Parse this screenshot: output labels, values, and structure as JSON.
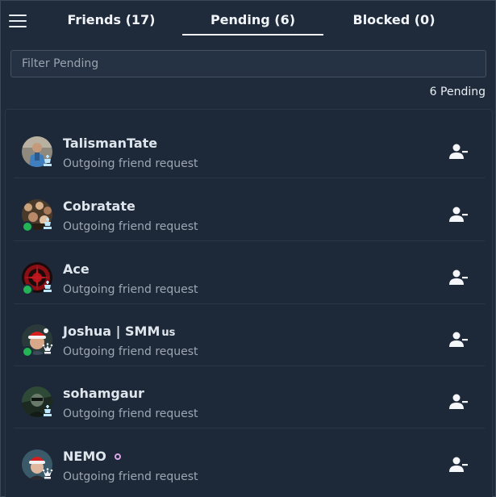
{
  "tabs": [
    {
      "label": "Friends (17)"
    },
    {
      "label": "Pending (6)"
    },
    {
      "label": "Blocked (0)"
    }
  ],
  "active_tab": "Pending (6)",
  "filter": {
    "placeholder": "Filter Pending",
    "value": ""
  },
  "pending_count_label": "6 Pending",
  "colors": {
    "online": "#22b455",
    "accent": "#f1f4f8",
    "badge": "#bfe6ff"
  },
  "requests": [
    {
      "name": "TalismanTate",
      "suffix": "",
      "subtitle": "Outgoing friend request",
      "online": false,
      "badge": "chess-king-icon",
      "avatar": "person-avatar"
    },
    {
      "name": "Cobratate",
      "suffix": "",
      "subtitle": "Outgoing friend request",
      "online": true,
      "badge": "chess-king-icon",
      "avatar": "group-avatar"
    },
    {
      "name": "Ace",
      "suffix": "",
      "subtitle": "Outgoing friend request",
      "online": true,
      "badge": "chess-king-icon",
      "avatar": "red-emblem-avatar"
    },
    {
      "name": "Joshua | SMM",
      "suffix": "us",
      "subtitle": "Outgoing friend request",
      "online": true,
      "badge": "chess-queen-icon",
      "avatar": "santa-hat-avatar"
    },
    {
      "name": "sohamgaur",
      "suffix": "",
      "subtitle": "Outgoing friend request",
      "online": false,
      "badge": "chess-king-icon",
      "avatar": "dark-portrait-avatar"
    },
    {
      "name": "NEMO",
      "suffix": "",
      "subtitle": "Outgoing friend request",
      "online": false,
      "badge": "chess-queen-icon",
      "avatar": "santa-hat-avatar-2",
      "name_icon": "ring-icon"
    }
  ]
}
